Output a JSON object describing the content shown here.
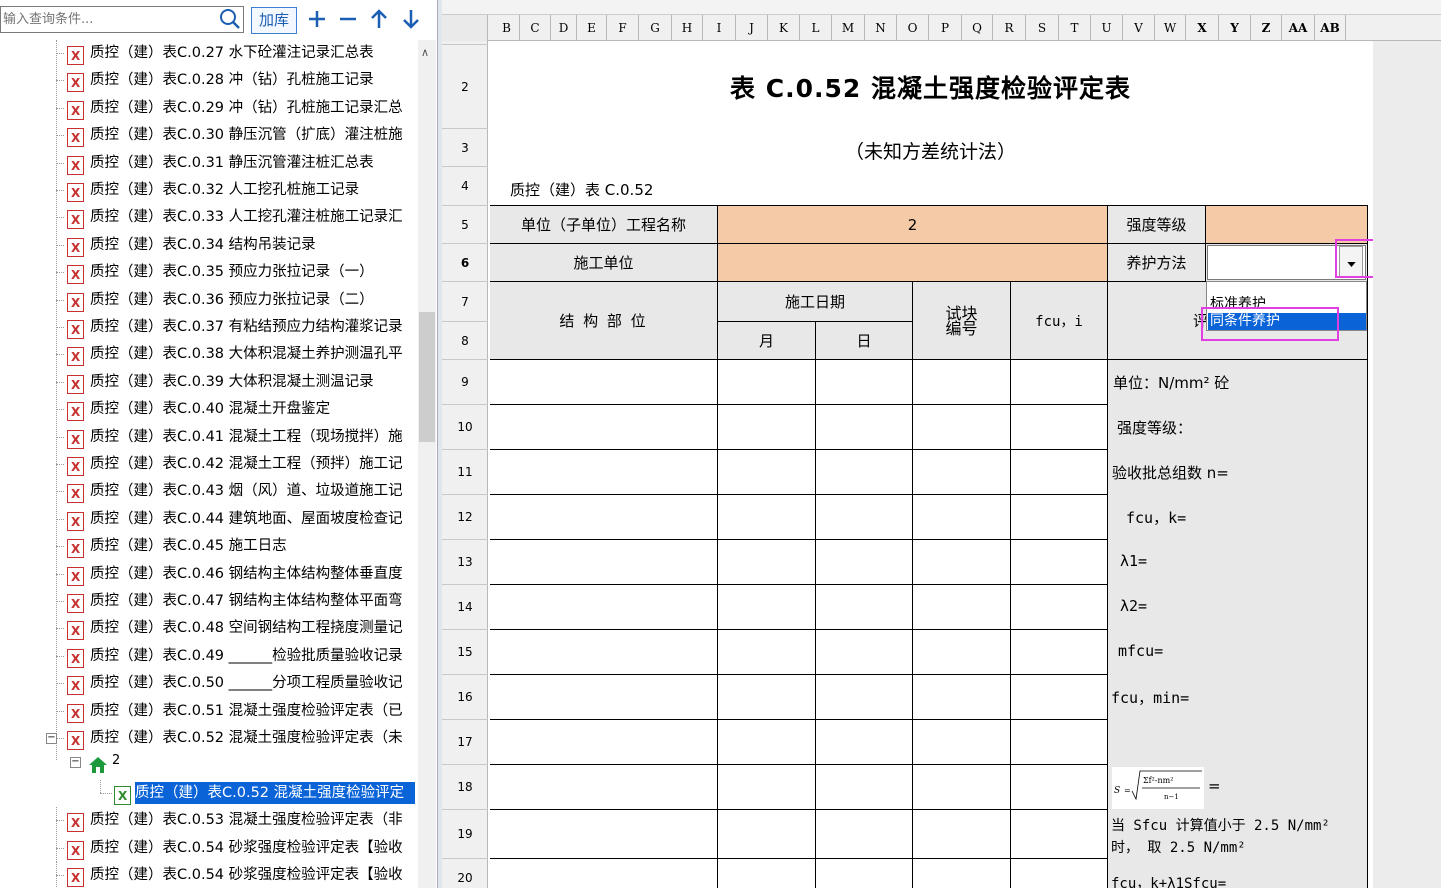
{
  "search": {
    "placeholder": "输入查询条件...",
    "add_lib_label": "加库"
  },
  "toolbar": {
    "add": "+",
    "remove": "−",
    "up": "↑",
    "down": "↓"
  },
  "tree": {
    "items": [
      "质控（建）表C.0.27 水下砼灌注记录汇总表",
      "质控（建）表C.0.28 冲（钻）孔桩施工记录",
      "质控（建）表C.0.29 冲（钻）孔桩施工记录汇总",
      "质控（建）表C.0.30 静压沉管（扩底）灌注桩施",
      "质控（建）表C.0.31 静压沉管灌注桩汇总表",
      "质控（建）表C.0.32 人工挖孔桩施工记录",
      "质控（建）表C.0.33 人工挖孔灌注桩施工记录汇",
      "质控（建）表C.0.34 结构吊装记录",
      "质控（建）表C.0.35 预应力张拉记录（一）",
      "质控（建）表C.0.36 预应力张拉记录（二）",
      "质控（建）表C.0.37 有粘结预应力结构灌浆记录",
      "质控（建）表C.0.38 大体积混凝土养护测温孔平",
      "质控（建）表C.0.39 大体积混凝土测温记录",
      "质控（建）表C.0.40 混凝土开盘鉴定",
      "质控（建）表C.0.41 混凝土工程（现场搅拌）施",
      "质控（建）表C.0.42 混凝土工程（预拌）施工记",
      "质控（建）表C.0.43 烟（风）道、垃圾道施工记",
      "质控（建）表C.0.44 建筑地面、屋面坡度检查记",
      "质控（建）表C.0.45 施工日志",
      "质控（建）表C.0.46 钢结构主体结构整体垂直度",
      "质控（建）表C.0.47 钢结构主体结构整体平面弯",
      "质控（建）表C.0.48 空间钢结构工程挠度测量记",
      "质控（建）表C.0.49 ______检验批质量验收记录",
      "质控（建）表C.0.50 ______分项工程质量验收记",
      "质控（建）表C.0.51 混凝土强度检验评定表（已",
      "质控（建）表C.0.52 混凝土强度检验评定表（未"
    ],
    "child_node": "2",
    "selected_item": "质控（建）表C.0.52 混凝土强度检验评定",
    "items_after": [
      "质控（建）表C.0.53 混凝土强度检验评定表（非",
      "质控（建）表C.0.54 砂浆强度检验评定表【验收",
      "质控（建）表C.0.54 砂浆强度检验评定表【验收"
    ]
  },
  "sheet": {
    "columns": [
      "B",
      "C",
      "D",
      "E",
      "F",
      "G",
      "H",
      "I",
      "J",
      "K",
      "L",
      "M",
      "N",
      "O",
      "P",
      "Q",
      "R",
      "S",
      "T",
      "U",
      "V",
      "W",
      "X",
      "Y",
      "Z",
      "AA",
      "AB"
    ],
    "rows": [
      "2",
      "3",
      "4",
      "5",
      "6",
      "7",
      "8",
      "9",
      "10",
      "11",
      "12",
      "13",
      "14",
      "15",
      "16",
      "17",
      "18",
      "19",
      "20"
    ],
    "title": "表 C.0.52 混凝土强度检验评定表",
    "subtitle": "（未知方差统计法）",
    "form_code": "质控（建）表 C.0.52",
    "unit_project_label": "单位（子单位）工程名称",
    "unit_project_value": "2",
    "strength_grade_label": "强度等级",
    "construction_unit_label": "施工单位",
    "curing_method_label": "养护方法",
    "curing_method_value": "",
    "structure_part_header": "结 构 部 位",
    "construction_date_header": "施工日期",
    "month_header": "月",
    "day_header": "日",
    "specimen_no_header": "试块编号",
    "fcu_i_header": "fcu，i",
    "eval_header_partial": "评",
    "right_panel": {
      "unit": "单位：N/mm² 砼",
      "strength_grade": "强度等级：",
      "batch_total": "验收批总组数 n=",
      "fcu_k": "fcu，k=",
      "lambda1": "λ1=",
      "lambda2": "λ2=",
      "mfcu": "mfcu=",
      "fcu_min": "fcu，min=",
      "sfcu_eq": "=",
      "note_line1": "当 Sfcu 计算值小于 2.5 N/mm²",
      "note_line2": "时， 取 2.5 N/mm²",
      "fcu_k_plus": "fcu，k+λ1Sfcu="
    },
    "dropdown_options": [
      "标准养护",
      "同条件养护"
    ],
    "dropdown_selected": "同条件养护"
  },
  "colors": {
    "orange_cell": "#f5cba7",
    "selection": "#0a64d8",
    "highlight_box": "#e040e0"
  }
}
